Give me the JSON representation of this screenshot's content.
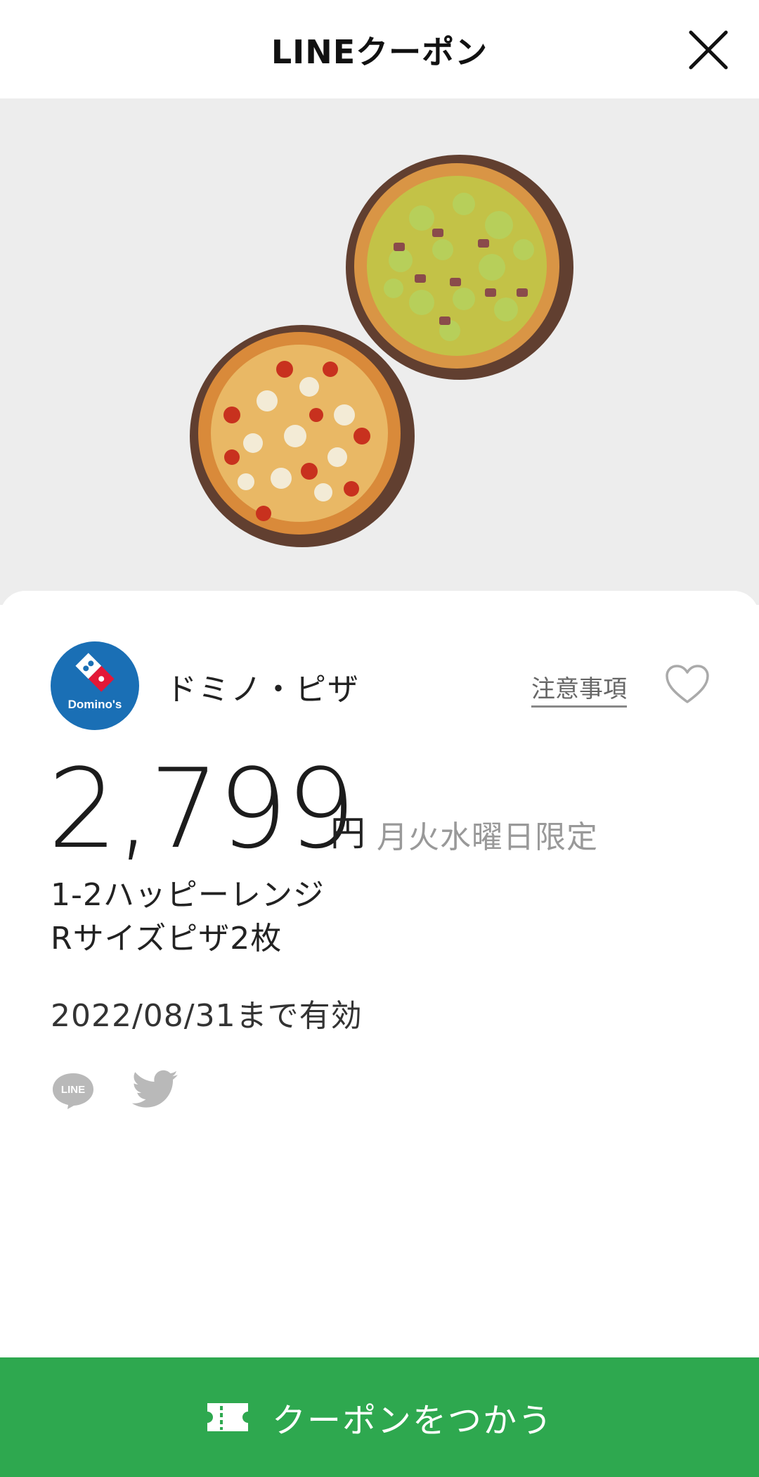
{
  "header": {
    "title": "LINEクーポン",
    "close_icon": "close-icon"
  },
  "hero": {
    "image": "two-pizzas-photo"
  },
  "shop": {
    "logo_text": "Domino's",
    "name": "ドミノ・ピザ",
    "notes_label": "注意事項",
    "favorite_icon": "heart-outline-icon"
  },
  "offer": {
    "price": "2,799",
    "currency": "円",
    "limitation": "月火水曜日限定",
    "description_line1": "1-2ハッピーレンジ",
    "description_line2": "Rサイズピザ2枚",
    "valid_until": "2022/08/31まで有効"
  },
  "share": {
    "line_icon_text": "LINE",
    "line_icon": "line-share-icon",
    "twitter_icon": "twitter-icon"
  },
  "action": {
    "use_label": "クーポンをつかう",
    "ticket_icon": "ticket-icon"
  },
  "colors": {
    "accent": "#2ea84f",
    "hero_bg": "#ededed",
    "domino_blue": "#1a6fb5",
    "domino_red": "#e31837"
  }
}
